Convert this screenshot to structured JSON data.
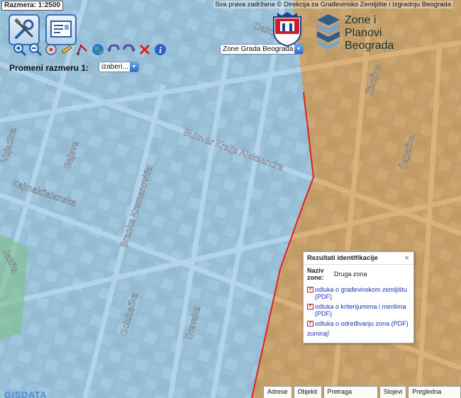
{
  "map": {
    "scale_display": "Razmera: 1:2500",
    "copyright": "Sva prava zadržana © Direkcija za Građevinsko Zemljište i Izgradnju Beograda",
    "colors": {
      "zone_blue": "#a9d3ef",
      "zone_orange": "#e0a45a",
      "boundary": "#dd2222"
    },
    "street_labels": [
      "Bulevar Kralja Aleksandra",
      "Kajmakčalanska",
      "Branka Krsmanovića",
      "Gajeva",
      "Golubačka",
      "Dravska",
      "Živojina",
      "Šabačka",
      "Dakov",
      "Vujadina",
      "Jakča"
    ]
  },
  "toolbar": {
    "big_buttons": [
      {
        "name": "tools-icon"
      },
      {
        "name": "document-icon"
      }
    ],
    "icons": [
      {
        "name": "zoom-in-icon",
        "glyph": "+"
      },
      {
        "name": "zoom-out-icon",
        "glyph": "−"
      },
      {
        "name": "info-globe-icon",
        "glyph": "◍"
      },
      {
        "name": "pencil-icon",
        "glyph": "✎"
      },
      {
        "name": "measure-icon",
        "glyph": "⌖"
      },
      {
        "name": "globe-icon",
        "glyph": "🌍"
      },
      {
        "name": "undo-icon",
        "glyph": "↶"
      },
      {
        "name": "redo-icon",
        "glyph": "↷"
      },
      {
        "name": "clear-icon",
        "glyph": "✕"
      },
      {
        "name": "info-icon",
        "glyph": "i"
      }
    ],
    "layer_select": "Zone Grada Beograda"
  },
  "scale_change": {
    "label": "Promeni razmeru 1:",
    "select_value": "izaberi..."
  },
  "logo": {
    "lines": [
      "Zone i",
      "Planovi",
      "Beograda"
    ]
  },
  "popup": {
    "title": "Rezultati identifikacije",
    "close_glyph": "×",
    "prop_label": "Naziv zone:",
    "prop_value": "Druga zona",
    "links": [
      "odluka o građevinskom zemljištu (PDF)",
      "odluka o kriterijumima i merilima (PDF)",
      "odluka o određivanju zona (PDF)"
    ],
    "zoom_link": "zumiraj!"
  },
  "bottom_tabs": [
    "Adrese",
    "Objekti",
    "Pretraga planova",
    "Slojevi",
    "Pregledna mapa"
  ],
  "footer_logo": "GISDATA"
}
